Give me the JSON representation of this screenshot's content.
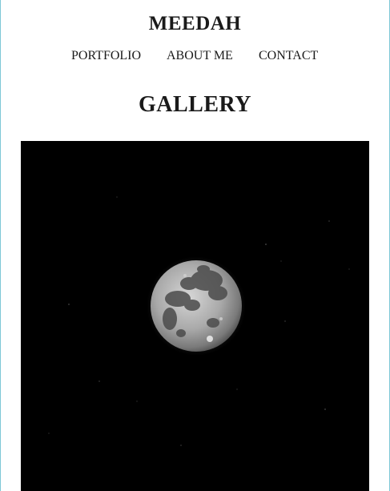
{
  "site": {
    "brand": "MEEDAH"
  },
  "nav": {
    "items": [
      {
        "label": "PORTFOLIO"
      },
      {
        "label": "ABOUT ME"
      },
      {
        "label": "CONTACT"
      }
    ]
  },
  "main": {
    "heading": "GALLERY"
  },
  "colors": {
    "background": "#ffffff",
    "text": "#1a1a1a",
    "photo_background": "#000000",
    "frame_accent": "#7ec8d6"
  }
}
